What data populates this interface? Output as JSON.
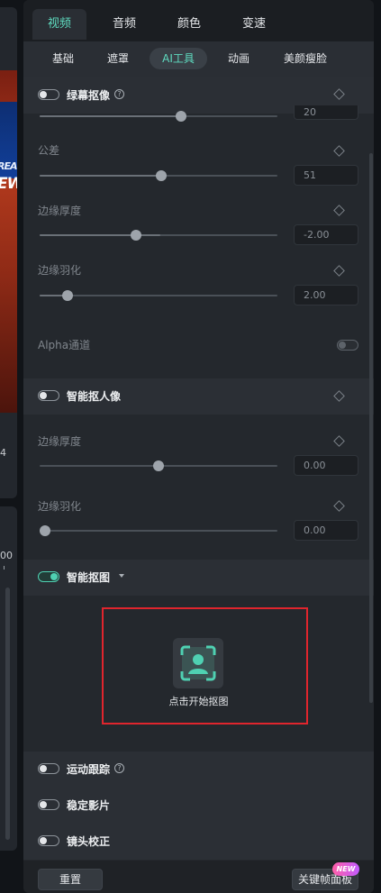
{
  "tabs": [
    {
      "label": "视频",
      "active": true
    },
    {
      "label": "音频",
      "active": false
    },
    {
      "label": "颜色",
      "active": false
    },
    {
      "label": "变速",
      "active": false
    }
  ],
  "subtabs": [
    {
      "label": "基础",
      "active": false
    },
    {
      "label": "遮罩",
      "active": false
    },
    {
      "label": "AI工具",
      "active": true
    },
    {
      "label": "动画",
      "active": false
    },
    {
      "label": "美颜瘦脸",
      "active": false
    }
  ],
  "left_panel": {
    "preview_text_1": "REA",
    "preview_text_2": "EW",
    "digit": "4",
    "bottom_label": "00"
  },
  "green_screen": {
    "title": "绿幕抠像",
    "enabled": false,
    "top_value": "20",
    "tolerance": {
      "label": "公差",
      "value": "51",
      "level": 0.51
    },
    "edge_thickness": {
      "label": "边缘厚度",
      "value": "-2.00",
      "level": 0.41
    },
    "edge_feather": {
      "label": "边缘羽化",
      "value": "2.00",
      "level": 0.12
    },
    "alpha": {
      "label": "Alpha通道",
      "enabled": false
    }
  },
  "smart_portrait": {
    "title": "智能抠人像",
    "enabled": false,
    "edge_thickness": {
      "label": "边缘厚度",
      "value": "0.00",
      "level": 0.5
    },
    "edge_feather": {
      "label": "边缘羽化",
      "value": "0.00",
      "level": 0.0
    }
  },
  "smart_cutout": {
    "title": "智能抠图",
    "enabled": true,
    "start_label": "点击开始抠图"
  },
  "motion_tracking": {
    "title": "运动跟踪",
    "enabled": false
  },
  "stabilize": {
    "title": "稳定影片",
    "enabled": false
  },
  "lens_correction": {
    "title": "镜头校正",
    "enabled": false
  },
  "footer": {
    "reset_label": "重置",
    "keyframe_label": "关键帧面板",
    "new_badge": "NEW"
  },
  "colors": {
    "accent": "#5fdcc0",
    "highlight": "#e0252d",
    "new_badge": "#ff5fa8"
  },
  "icons": {
    "help": "help-circle-icon",
    "keyframe": "diamond-icon",
    "cutout": "person-scan-icon",
    "dropdown": "caret-down-icon"
  }
}
